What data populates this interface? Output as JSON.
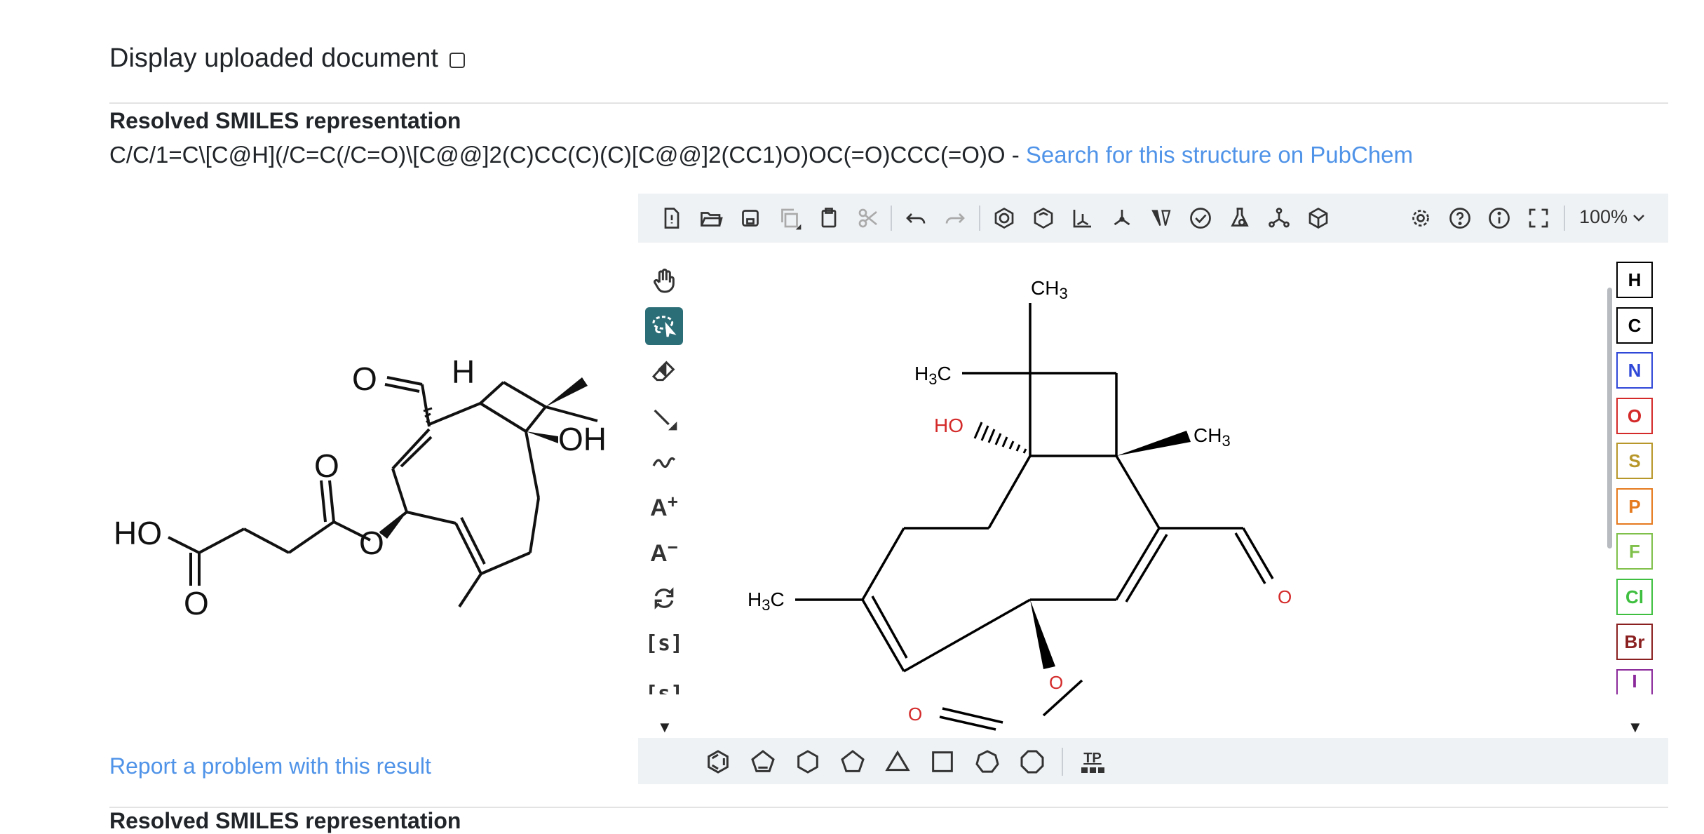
{
  "display_uploaded": {
    "label": "Display uploaded document",
    "checked": false
  },
  "resolved": {
    "heading": "Resolved SMILES representation",
    "smiles": "C/C/1=C\\[C@H](/C=C(/C=O)\\[C@@]2(C)CC(C)(C)[C@@]2(CC1)O)OC(=O)CCC(=O)O",
    "separator": " - ",
    "pubchem_link": "Search for this structure on PubChem"
  },
  "report_link": "Report a problem with this result",
  "cutoff_heading": "Resolved SMILES representation",
  "source_image": {
    "atoms": {
      "o_aldehyde": "O",
      "h": "H",
      "oh": "OH",
      "o_ester_carbonyl": "O",
      "ho": "HO",
      "o_acid": "O",
      "o_ester": "O"
    }
  },
  "editor": {
    "zoom": "100%",
    "top_toolbar_icons": [
      "new-file-icon",
      "open-folder-icon",
      "save-icon",
      "copy-icon",
      "paste-icon",
      "cut-icon",
      "undo-icon",
      "redo-icon",
      "aromatize-icon",
      "dearomatize-icon",
      "layout-icon",
      "clean-icon",
      "stereo-icon",
      "check-structure-icon",
      "calculate-icon",
      "recognize-icon",
      "3d-viewer-icon",
      "settings-icon",
      "help-icon",
      "about-icon",
      "fullscreen-icon"
    ],
    "left_tools": {
      "charge_plus": "A",
      "charge_minus": "A",
      "sgroup": "[s]",
      "sgroup_cut": "[s]"
    },
    "elements": [
      {
        "symbol": "H",
        "color": "#000000"
      },
      {
        "symbol": "C",
        "color": "#000000"
      },
      {
        "symbol": "N",
        "color": "#3048d8"
      },
      {
        "symbol": "O",
        "color": "#d42a2a"
      },
      {
        "symbol": "S",
        "color": "#b8972a"
      },
      {
        "symbol": "P",
        "color": "#e57a1e"
      },
      {
        "symbol": "F",
        "color": "#7fc04a"
      },
      {
        "symbol": "Cl",
        "color": "#3fbf3f"
      },
      {
        "symbol": "Br",
        "color": "#8b2020"
      },
      {
        "symbol": "I",
        "color": "#8b2a9b"
      }
    ],
    "bottom_tools": {
      "template_library": "TP"
    },
    "canvas_labels": {
      "ch3_top": "CH",
      "ch3_top_sub": "3",
      "h3c_left_top": "H",
      "h3c_left_top_sub": "3",
      "h3c_left_top_c": "C",
      "ho": "HO",
      "ch3_right": "CH",
      "ch3_right_sub": "3",
      "h3c_left": "H",
      "h3c_left_sub": "3",
      "h3c_left_c": "C",
      "o_aldehyde": "O",
      "o_ester": "O",
      "o_carbonyl": "O"
    },
    "colors": {
      "heteroatom": "#d42a2a",
      "toolbar_bg": "#eff2f5",
      "active_tool": "#2c6e77",
      "link": "#4f93e8"
    }
  }
}
